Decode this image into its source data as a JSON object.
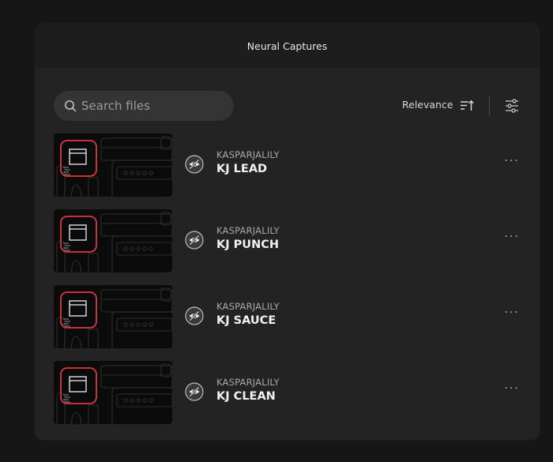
{
  "header": {
    "title": "Neural Captures"
  },
  "search": {
    "placeholder": "Search files",
    "value": ""
  },
  "sort": {
    "label": "Relevance"
  },
  "colors": {
    "accent": "#e0393b",
    "panel": "#232323",
    "background": "#161616"
  },
  "captures": [
    {
      "owner": "KASPARJALILY",
      "name": "KJ LEAD",
      "more": "···"
    },
    {
      "owner": "KASPARJALILY",
      "name": "KJ PUNCH",
      "more": "···"
    },
    {
      "owner": "KASPARJALILY",
      "name": "KJ SAUCE",
      "more": "···"
    },
    {
      "owner": "KASPARJALILY",
      "name": "KJ CLEAN",
      "more": "···"
    }
  ]
}
